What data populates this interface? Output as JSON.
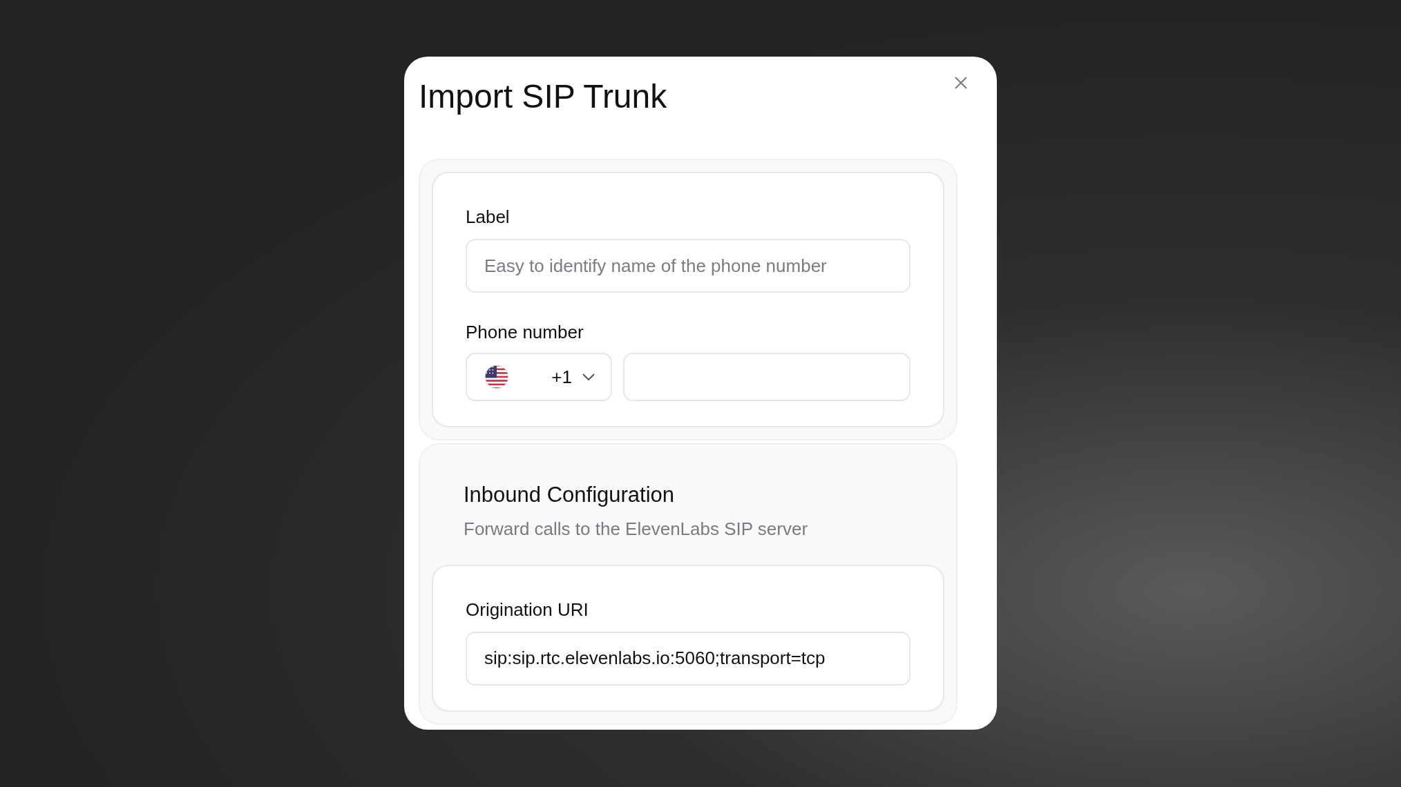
{
  "dialog": {
    "title": "Import SIP Trunk"
  },
  "sections": [
    {
      "kind": "plain",
      "fields": [
        {
          "kind": "text",
          "label": "Label",
          "placeholder": "Easy to identify name of the phone number"
        },
        {
          "kind": "phone",
          "label": "Phone number",
          "country_code": "+1"
        }
      ]
    },
    {
      "kind": "group",
      "heading": "Inbound Configuration",
      "description": "Forward calls to the ElevenLabs SIP server",
      "fields": [
        {
          "kind": "text",
          "label": "Origination URI",
          "value": "sip:sip.rtc.elevenlabs.io:5060;transport=tcp"
        }
      ]
    }
  ]
}
